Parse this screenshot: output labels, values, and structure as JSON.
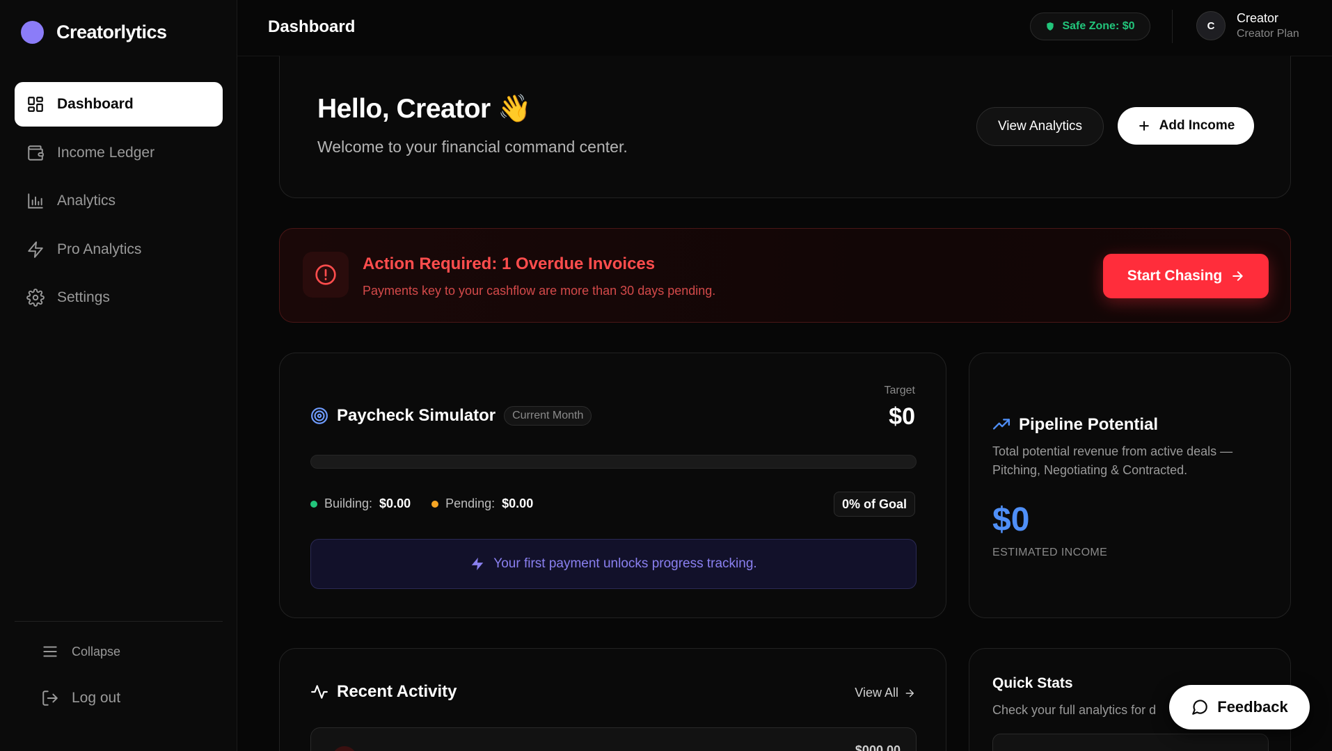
{
  "brand": {
    "name": "Creatorlytics"
  },
  "sidebar": {
    "items": [
      {
        "label": "Dashboard",
        "icon": "dashboard-grid-icon",
        "active": true
      },
      {
        "label": "Income Ledger",
        "icon": "wallet-icon",
        "active": false
      },
      {
        "label": "Analytics",
        "icon": "bar-chart-icon",
        "active": false
      },
      {
        "label": "Pro Analytics",
        "icon": "lightning-icon",
        "active": false
      },
      {
        "label": "Settings",
        "icon": "gear-icon",
        "active": false
      }
    ],
    "collapse_label": "Collapse",
    "logout_label": "Log out"
  },
  "header": {
    "title": "Dashboard",
    "safe_zone": "Safe Zone: $0",
    "user": {
      "initial": "C",
      "name": "Creator",
      "plan": "Creator Plan"
    }
  },
  "hello": {
    "title": "Hello, Creator 👋",
    "subtitle": "Welcome to your financial command center.",
    "view_analytics": "View Analytics",
    "add_income": "Add Income"
  },
  "alert": {
    "title": "Action Required: 1 Overdue Invoices",
    "subtitle": "Payments key to your cashflow are more than 30 days pending.",
    "button": "Start Chasing"
  },
  "paycheck": {
    "title": "Paycheck Simulator",
    "pill": "Current Month",
    "target_label": "Target",
    "target_value": "$0",
    "progress_fraction": 0,
    "building_label": "Building:",
    "building_value": "$0.00",
    "pending_label": "Pending:",
    "pending_value": "$0.00",
    "goal": "0% of Goal",
    "unlock_text": "Your first payment unlocks progress tracking."
  },
  "pipeline": {
    "title": "Pipeline Potential",
    "description": "Total potential revenue from active deals — Pitching, Negotiating & Contracted.",
    "value": "$0",
    "label": "ESTIMATED INCOME"
  },
  "activity": {
    "title": "Recent Activity",
    "view_all": "View All",
    "first_amount": "$000.00"
  },
  "stats": {
    "title": "Quick Stats",
    "subtitle": "Check your full analytics for d"
  },
  "feedback": {
    "label": "Feedback"
  },
  "colors": {
    "accent": "#8b7cf8",
    "danger": "#ff2d3b",
    "safe": "#22c57b",
    "pipeline": "#4f8ff7",
    "building": "#22c57b",
    "pending": "#f5a524"
  }
}
